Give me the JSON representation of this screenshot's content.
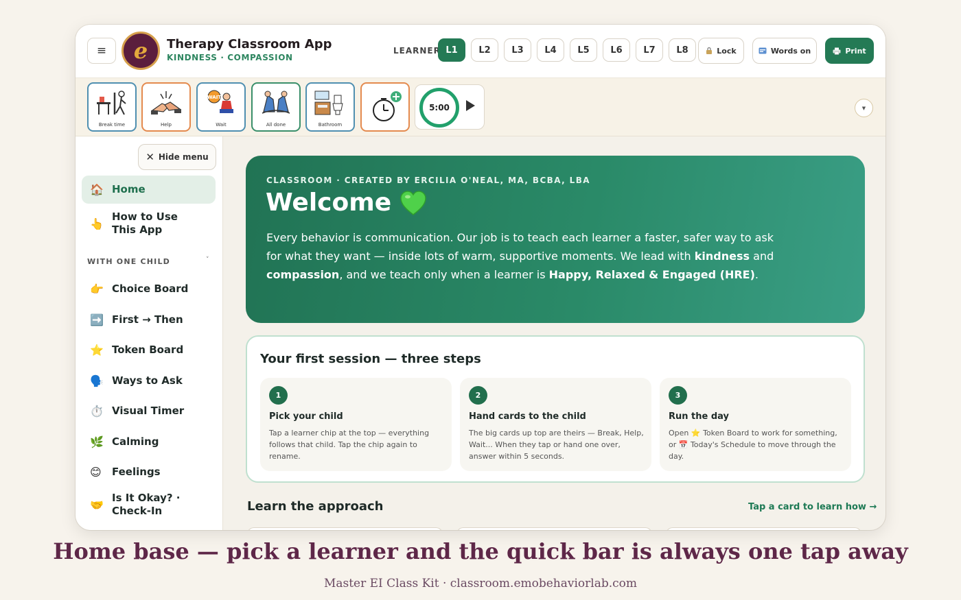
{
  "header": {
    "app_title": "Therapy Classroom App",
    "app_subtitle": "KINDNESS · COMPASSION",
    "logo_letter": "e",
    "learner_label": "LEARNER",
    "learners": [
      "L1",
      "L2",
      "L3",
      "L4",
      "L5",
      "L6",
      "L7",
      "L8"
    ],
    "active_learner": "L1",
    "lock_label": "Lock",
    "words_label": "Words on",
    "print_label": "Print"
  },
  "quickbar": {
    "cards": [
      {
        "label": "Break time",
        "icon": "break-time-icon"
      },
      {
        "label": "Help",
        "icon": "help-hands-icon"
      },
      {
        "label": "Wait",
        "icon": "wait-icon",
        "badge": "WAIT"
      },
      {
        "label": "All done",
        "icon": "all-done-icon"
      },
      {
        "label": "Bathroom",
        "icon": "bathroom-icon"
      },
      {
        "label": "",
        "icon": "add-timer-icon"
      }
    ],
    "timer_value": "5:00"
  },
  "sidebar": {
    "hide_label": "Hide menu",
    "items": [
      {
        "label": "Home",
        "icon": "🏠"
      },
      {
        "label": "How to Use This App",
        "icon": "👆"
      }
    ],
    "section_label": "WITH ONE CHILD",
    "section_items": [
      {
        "label": "Choice Board",
        "icon": "👉"
      },
      {
        "label": "First → Then",
        "icon": "➡️"
      },
      {
        "label": "Token Board",
        "icon": "⭐"
      },
      {
        "label": "Ways to Ask",
        "icon": "🗣️"
      },
      {
        "label": "Visual Timer",
        "icon": "⏱️"
      },
      {
        "label": "Calming",
        "icon": "🌿"
      },
      {
        "label": "Feelings",
        "icon": "😊"
      },
      {
        "label": "Is It Okay? · Check-In",
        "icon": "🤝"
      }
    ]
  },
  "hero": {
    "kicker": "CLASSROOM · CREATED BY ERCILIA O'NEAL, MA, BCBA, LBA",
    "title": "Welcome",
    "body_1": "Every behavior is communication. Our job is to teach each learner a faster, safer way to ask for what they want — inside lots of warm, supportive moments. We lead with ",
    "bold_1": "kindness",
    "body_2": " and ",
    "bold_2": "compassion",
    "body_3": ", and we teach only when a learner is ",
    "bold_3": "Happy, Relaxed & Engaged (HRE)",
    "body_4": "."
  },
  "steps": {
    "title": "Your first session — three steps",
    "items": [
      {
        "num": "1",
        "title": "Pick your child",
        "text": "Tap a learner chip at the top — everything follows that child. Tap the chip again to rename."
      },
      {
        "num": "2",
        "title": "Hand cards to the child",
        "text": "The big cards up top are theirs — Break, Help, Wait... When they tap or hand one over, answer within 5 seconds."
      },
      {
        "num": "3",
        "title": "Run the day",
        "text": "Open ⭐ Token Board to work for something, or 📅 Today's Schedule to move through the day."
      }
    ]
  },
  "learn": {
    "title": "Learn the approach",
    "link": "Tap a card to learn how →"
  },
  "caption": "Home base — pick a learner and the quick bar is always one tap away",
  "footer": "Master EI Class Kit · classroom.emobehaviorlab.com",
  "colors": {
    "brand_green": "#247a55",
    "logo_plum": "#5b1e3d",
    "caption_plum": "#5e2748"
  }
}
